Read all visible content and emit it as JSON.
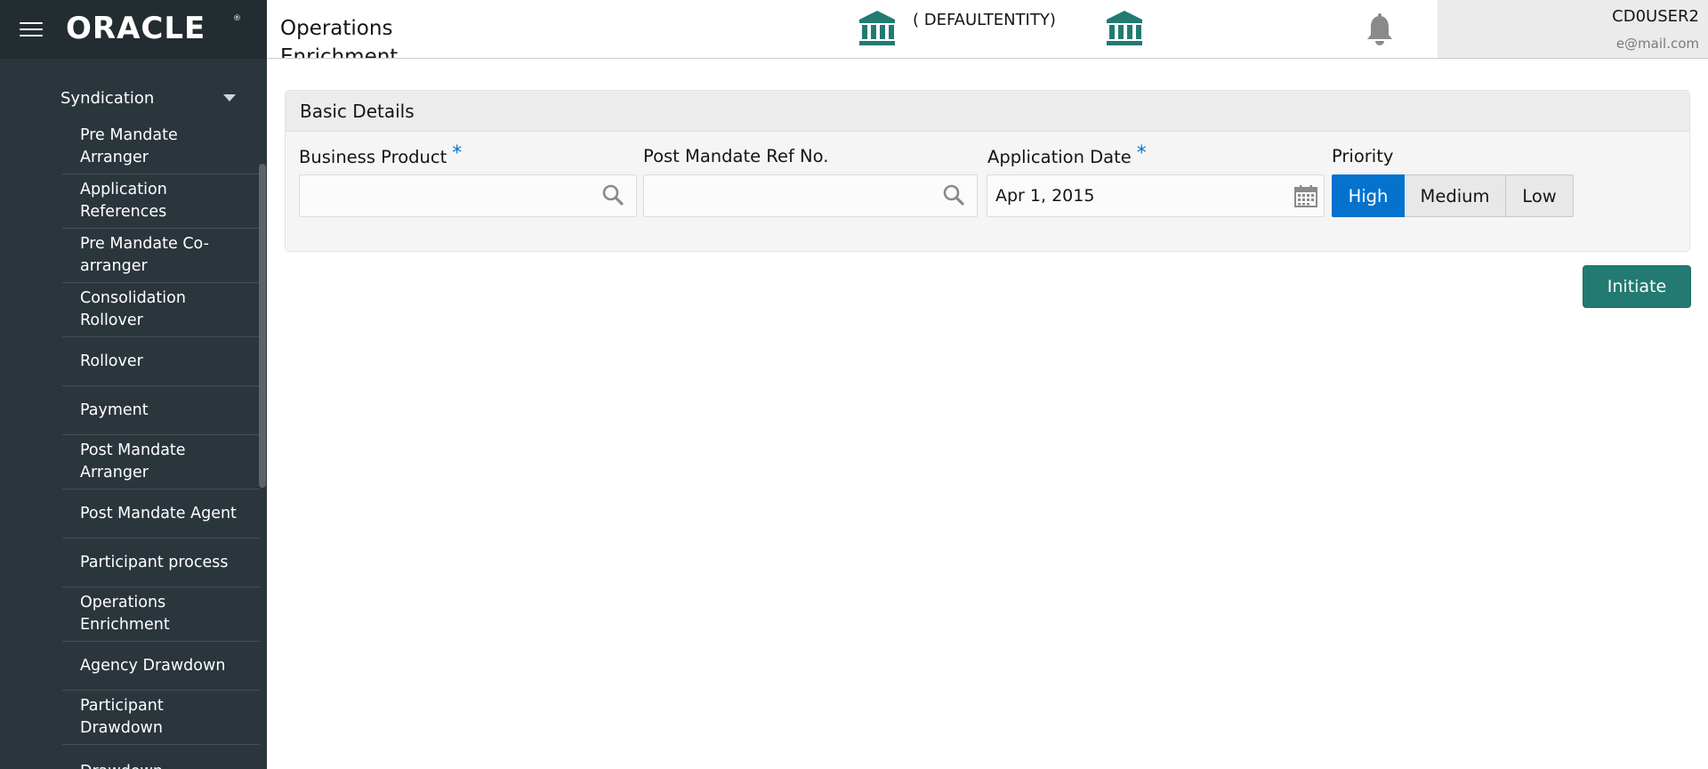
{
  "brand": {
    "logo_text": "ORACLE",
    "logo_mark": "®",
    "menu_icon": "hamburger-menu-icon"
  },
  "sidebar": {
    "group_label": "Syndication",
    "group_icon": "caret-down-icon",
    "items": [
      {
        "label": "Pre Mandate Arranger"
      },
      {
        "label": "Application References"
      },
      {
        "label": "Pre Mandate Co-arranger"
      },
      {
        "label": "Consolidation Rollover"
      },
      {
        "label": "Rollover"
      },
      {
        "label": "Payment"
      },
      {
        "label": "Post Mandate Arranger"
      },
      {
        "label": "Post Mandate Agent"
      },
      {
        "label": "Participant process"
      },
      {
        "label": "Operations Enrichment"
      },
      {
        "label": "Agency Drawdown"
      },
      {
        "label": "Participant Drawdown"
      },
      {
        "label": "Drawdown"
      }
    ]
  },
  "header": {
    "page_title": "Operations Enrichment",
    "entity_label": "( DEFAULTENTITY)",
    "entity_icon": "bank-icon",
    "branch_icon": "bank-icon",
    "notification_icon": "bell-icon",
    "user_name": "CD0USER2",
    "user_email": "e@mail.com"
  },
  "form": {
    "section_title": "Basic Details",
    "business_product": {
      "label": "Business Product",
      "required_mark": "*",
      "value": "",
      "icon": "search-icon"
    },
    "post_mandate_ref": {
      "label": "Post Mandate Ref No.",
      "value": "",
      "icon": "search-icon"
    },
    "application_date": {
      "label": "Application Date",
      "required_mark": "*",
      "value": "Apr 1, 2015",
      "icon": "calendar-icon"
    },
    "priority": {
      "label": "Priority",
      "options": [
        "High",
        "Medium",
        "Low"
      ],
      "selected": "High"
    }
  },
  "actions": {
    "initiate_label": "Initiate"
  },
  "colors": {
    "sidebar_bg": "#2b353c",
    "brand_bg": "#232c31",
    "accent_blue": "#0572ce",
    "teal": "#227a72",
    "required": "#0572ce"
  }
}
